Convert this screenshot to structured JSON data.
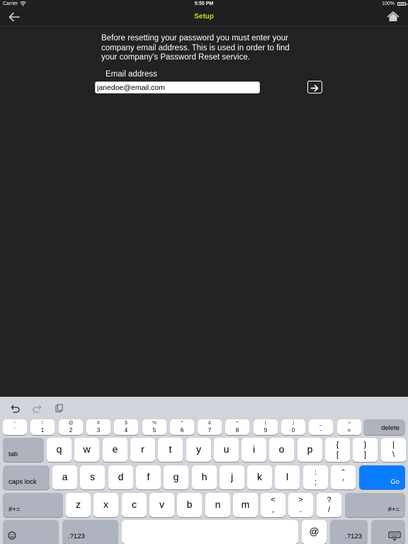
{
  "status_bar": {
    "carrier": "Carrier",
    "time": "5:55 PM",
    "battery": "100%"
  },
  "nav": {
    "title": "Setup",
    "title_color": "#c8de25"
  },
  "form": {
    "instructions": "Before resetting your password you must enter your company email address. This is used in order to find your company's Password Reset service.",
    "email_label": "Email address",
    "email_value": "janedoe@email.com"
  },
  "keyboard": {
    "number_row": [
      {
        "top": "~",
        "bottom": "`"
      },
      {
        "top": "!",
        "bottom": "1"
      },
      {
        "top": "@",
        "bottom": "2"
      },
      {
        "top": "#",
        "bottom": "3"
      },
      {
        "top": "$",
        "bottom": "4"
      },
      {
        "top": "%",
        "bottom": "5"
      },
      {
        "top": "^",
        "bottom": "6"
      },
      {
        "top": "&",
        "bottom": "7"
      },
      {
        "top": "*",
        "bottom": "8"
      },
      {
        "top": "(",
        "bottom": "9"
      },
      {
        "top": ")",
        "bottom": "0"
      },
      {
        "top": "_",
        "bottom": "-"
      },
      {
        "top": "+",
        "bottom": "="
      }
    ],
    "delete_label": "delete",
    "tab_label": "tab",
    "row_q": [
      "q",
      "w",
      "e",
      "r",
      "t",
      "y",
      "u",
      "i",
      "o",
      "p"
    ],
    "row_q_symbols": [
      {
        "top": "{",
        "bottom": "["
      },
      {
        "top": "}",
        "bottom": "]"
      },
      {
        "top": "|",
        "bottom": "\\"
      }
    ],
    "caps_lock_label": "caps lock",
    "row_a": [
      "a",
      "s",
      "d",
      "f",
      "g",
      "h",
      "j",
      "k",
      "l"
    ],
    "row_a_symbols": [
      {
        "top": ":",
        "bottom": ";"
      },
      {
        "top": "”",
        "bottom": "’"
      }
    ],
    "go_label": "Go",
    "shift_left_label": "#+=",
    "row_z": [
      "z",
      "x",
      "c",
      "v",
      "b",
      "n",
      "m"
    ],
    "row_z_symbols": [
      {
        "top": "<",
        "bottom": ","
      },
      {
        "top": ">",
        "bottom": "."
      },
      {
        "top": "?",
        "bottom": "/"
      }
    ],
    "shift_right_label": "#+=",
    "numbers_left_label": ".?123",
    "at_label": "@",
    "numbers_right_label": ".?123",
    "go_color": "#0a7cff"
  }
}
